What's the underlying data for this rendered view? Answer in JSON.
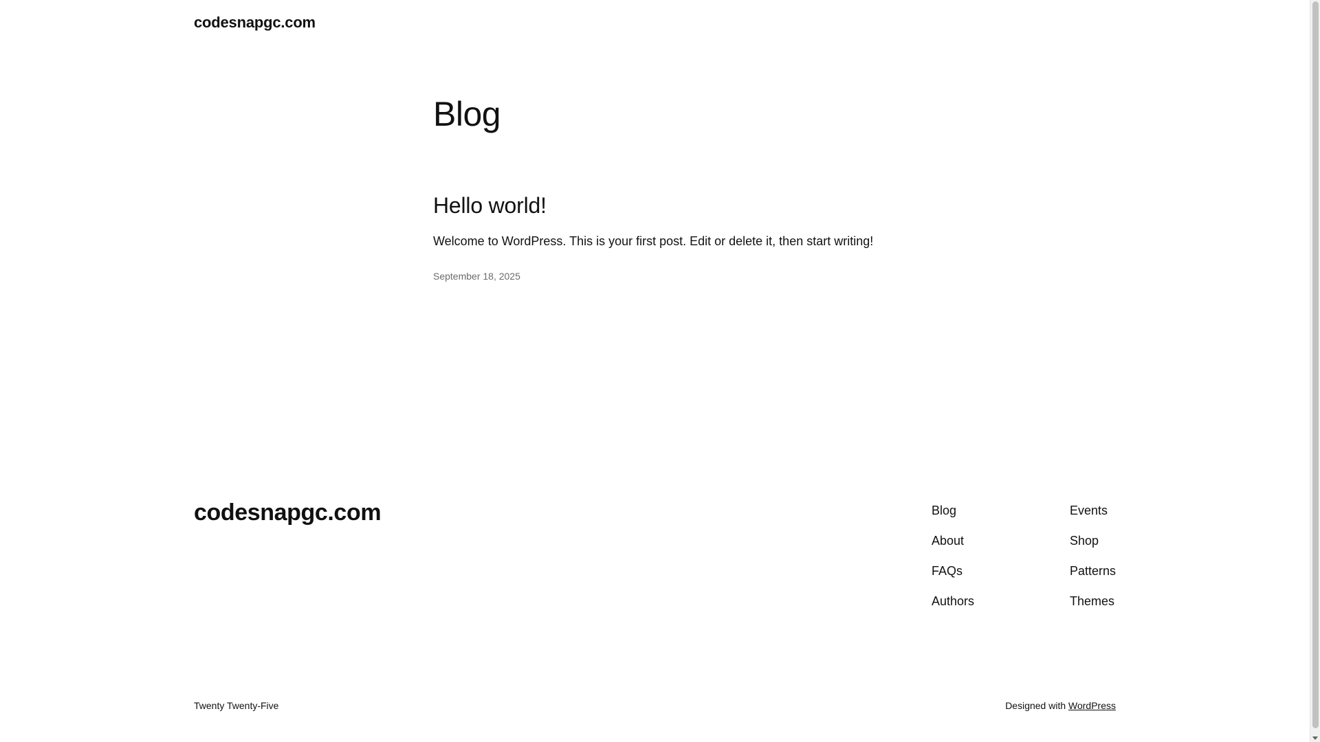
{
  "header": {
    "site_title": "codesnapgc.com"
  },
  "main": {
    "page_title": "Blog",
    "posts": [
      {
        "title": "Hello world!",
        "excerpt": "Welcome to WordPress. This is your first post. Edit or delete it, then start writing!",
        "date": "September 18, 2025"
      }
    ]
  },
  "footer": {
    "site_title": "codesnapgc.com",
    "nav_col_1": [
      "Blog",
      "About",
      "FAQs",
      "Authors"
    ],
    "nav_col_2": [
      "Events",
      "Shop",
      "Patterns",
      "Themes"
    ],
    "theme_credit": "Twenty Twenty-Five",
    "designed_with_prefix": "Designed with",
    "designed_with_link": "WordPress"
  }
}
